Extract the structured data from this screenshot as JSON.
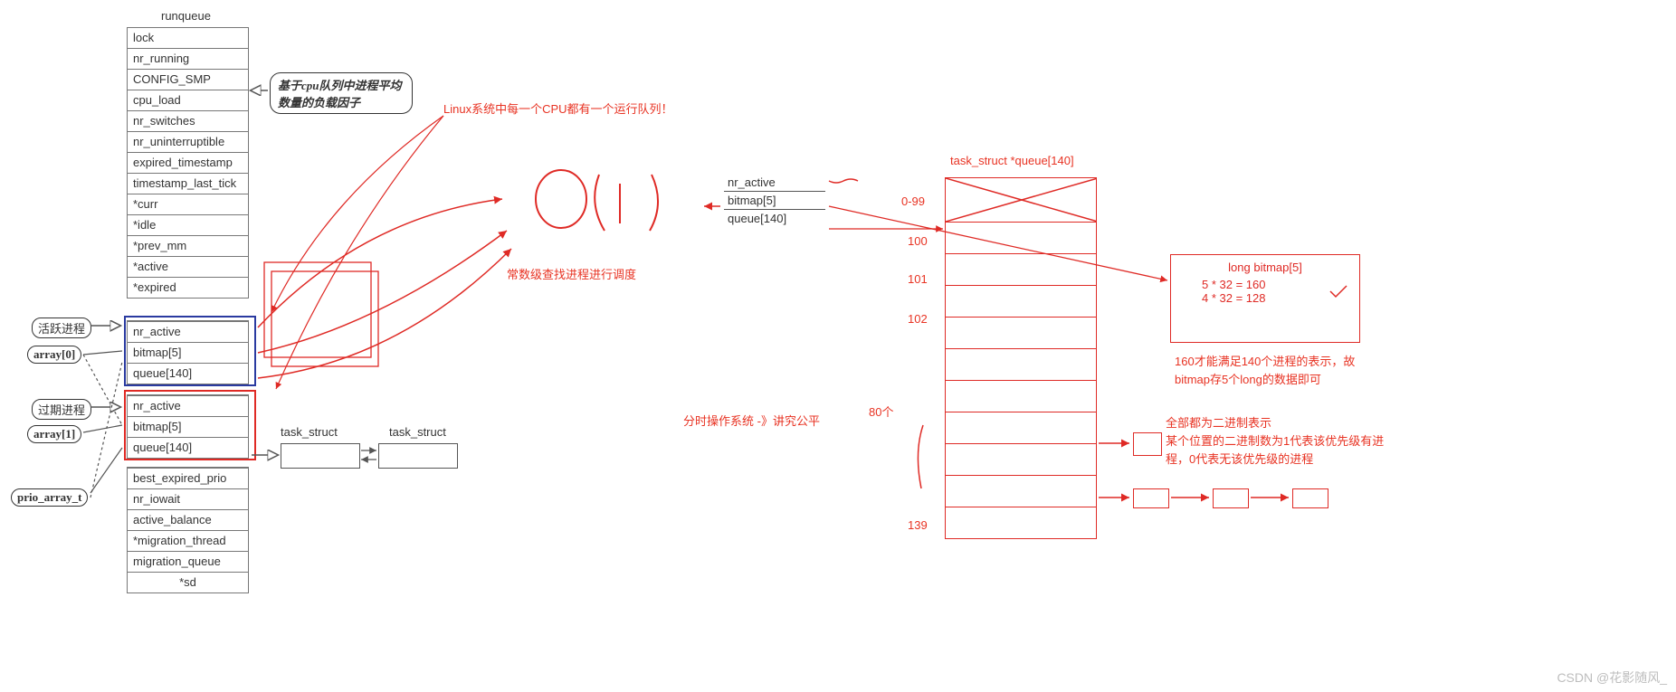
{
  "runqueue": {
    "title": "runqueue",
    "bubble": "基于cpu队列中进程平均数量的负载因子",
    "fields_top": [
      "lock",
      "nr_running",
      "CONFIG_SMP",
      "cpu_load",
      "nr_switches",
      "nr_uninterruptible",
      "expired_timestamp",
      "timestamp_last_tick",
      "*curr",
      "*idle",
      "*prev_mm",
      "*active",
      "*expired"
    ],
    "active_label": "活跃进程",
    "expired_label": "过期进程",
    "array0_label": "array[0]",
    "array1_label": "array[1]",
    "prio_label": "prio_array_t",
    "array0_fields": [
      "nr_active",
      "bitmap[5]",
      "queue[140]"
    ],
    "array1_fields": [
      "nr_active",
      "bitmap[5]",
      "queue[140]"
    ],
    "fields_bottom": [
      "best_expired_prio",
      "nr_iowait",
      "active_balance",
      "*migration_thread",
      "migration_queue",
      "*sd"
    ]
  },
  "task_struct": {
    "label1": "task_struct",
    "label2": "task_struct"
  },
  "midnotes": {
    "cpu_note": "Linux系统中每一个CPU都有一个运行队列！",
    "o1": "O(1)",
    "const_note": "常数级查找进程进行调度",
    "fair_note": "分时操作系统 -》讲究公平",
    "fair_count": "80个"
  },
  "mini_array": {
    "f1": "nr_active",
    "f2": "bitmap[5]",
    "f3": "queue[140]"
  },
  "queue": {
    "title": "task_struct *queue[140]",
    "idx": [
      "0-99",
      "100",
      "101",
      "102",
      "139"
    ]
  },
  "bitmap": {
    "title": "long bitmap[5]",
    "l1": "5 * 32 = 160",
    "l2": "4 * 32 = 128",
    "expl": "160才能满足140个进程的表示，故bitmap存5个long的数据即可",
    "bin1": "全部都为二进制表示",
    "bin2": "某个位置的二进制数为1代表该优先级有进程，0代表无该优先级的进程"
  },
  "watermark": "CSDN @花影随风_"
}
